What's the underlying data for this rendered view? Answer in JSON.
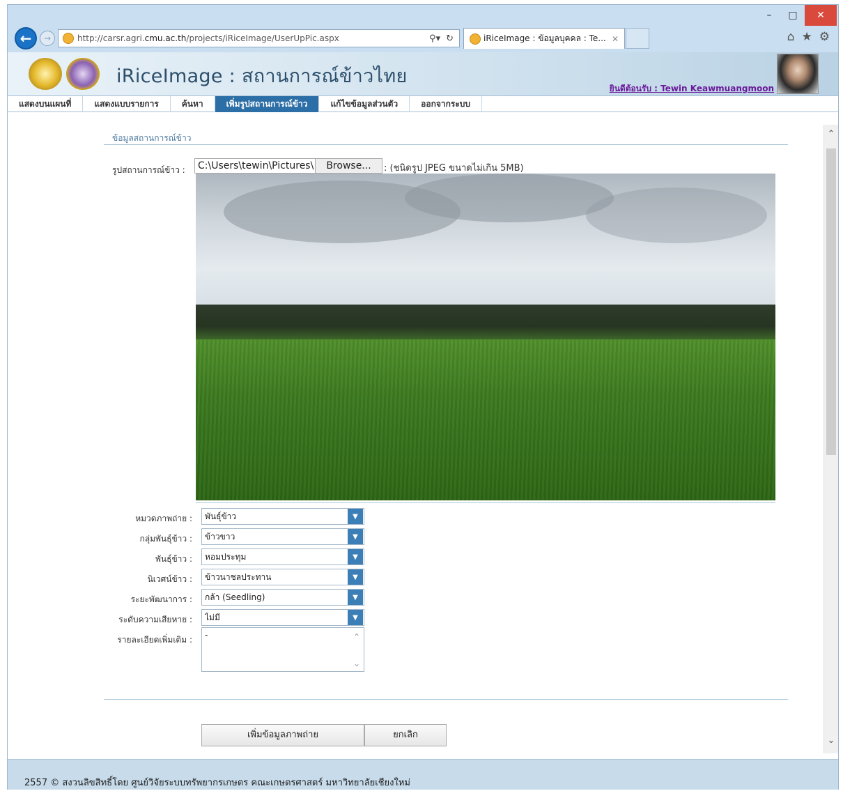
{
  "browser": {
    "url_prefix": "http://carsr.agri.",
    "url_domain": "cmu.ac.th",
    "url_path": "/projects/iRiceImage/UserUpPic.aspx",
    "tab_title": "iRiceImage : ข้อมูลบุคคล : Te..."
  },
  "header": {
    "title": "iRiceImage : สถานการณ์ข้าวไทย",
    "welcome": "ยินดีต้อนรับ : Tewin Keawmuangmoon"
  },
  "menu": [
    {
      "label": "แสดงบนแผนที่"
    },
    {
      "label": "แสดงแบบรายการ"
    },
    {
      "label": "ค้นหา"
    },
    {
      "label": "เพิ่มรูปสถานการณ์ข้าว"
    },
    {
      "label": "แก้ไขข้อมูลส่วนตัว"
    },
    {
      "label": "ออกจากระบบ"
    }
  ],
  "form": {
    "section_title": "ข้อมูลสถานการณ์ข้าว",
    "photo_label": "รูปสถานการณ์ข้าว :",
    "file_path": "C:\\Users\\tewin\\Pictures\\",
    "browse_label": "Browse...",
    "file_note": ": (ชนิดรูป JPEG ขนาดไม่เกิน 5MB)",
    "fields": [
      {
        "label": "หมวดภาพถ่าย :",
        "value": "พันธุ์ข้าว"
      },
      {
        "label": "กลุ่มพันธุ์ข้าว :",
        "value": "ข้าวขาว"
      },
      {
        "label": "พันธุ์ข้าว :",
        "value": "หอมประทุม"
      },
      {
        "label": "นิเวศน์ข้าว :",
        "value": "ข้าวนาชลประทาน"
      },
      {
        "label": "ระยะพัฒนาการ :",
        "value": "กล้า (Seedling)"
      },
      {
        "label": "ระดับความเสียหาย :",
        "value": "ไม่มี"
      }
    ],
    "details_label": "รายละเอียดเพิ่มเติม :",
    "details_value": "-",
    "submit_label": "เพิ่มข้อมูลภาพถ่าย",
    "cancel_label": "ยกเลิก"
  },
  "footer": {
    "text": "2557 © สงวนลิขสิทธิ์โดย ศูนย์วิจัยระบบทรัพยากรเกษตร คณะเกษตรศาสตร์ มหาวิทยาลัยเชียงใหม่"
  },
  "icons": {
    "back": "back-arrow-icon",
    "forward": "forward-arrow-icon",
    "search": "search-icon",
    "refresh": "refresh-icon",
    "home": "home-icon",
    "favorites": "star-icon",
    "settings": "gear-icon"
  },
  "colors": {
    "menu_active": "#2c6ea6",
    "header_title": "#2d4f6b",
    "welcome_link": "#6a1a9a",
    "close_button": "#d94a3c"
  }
}
